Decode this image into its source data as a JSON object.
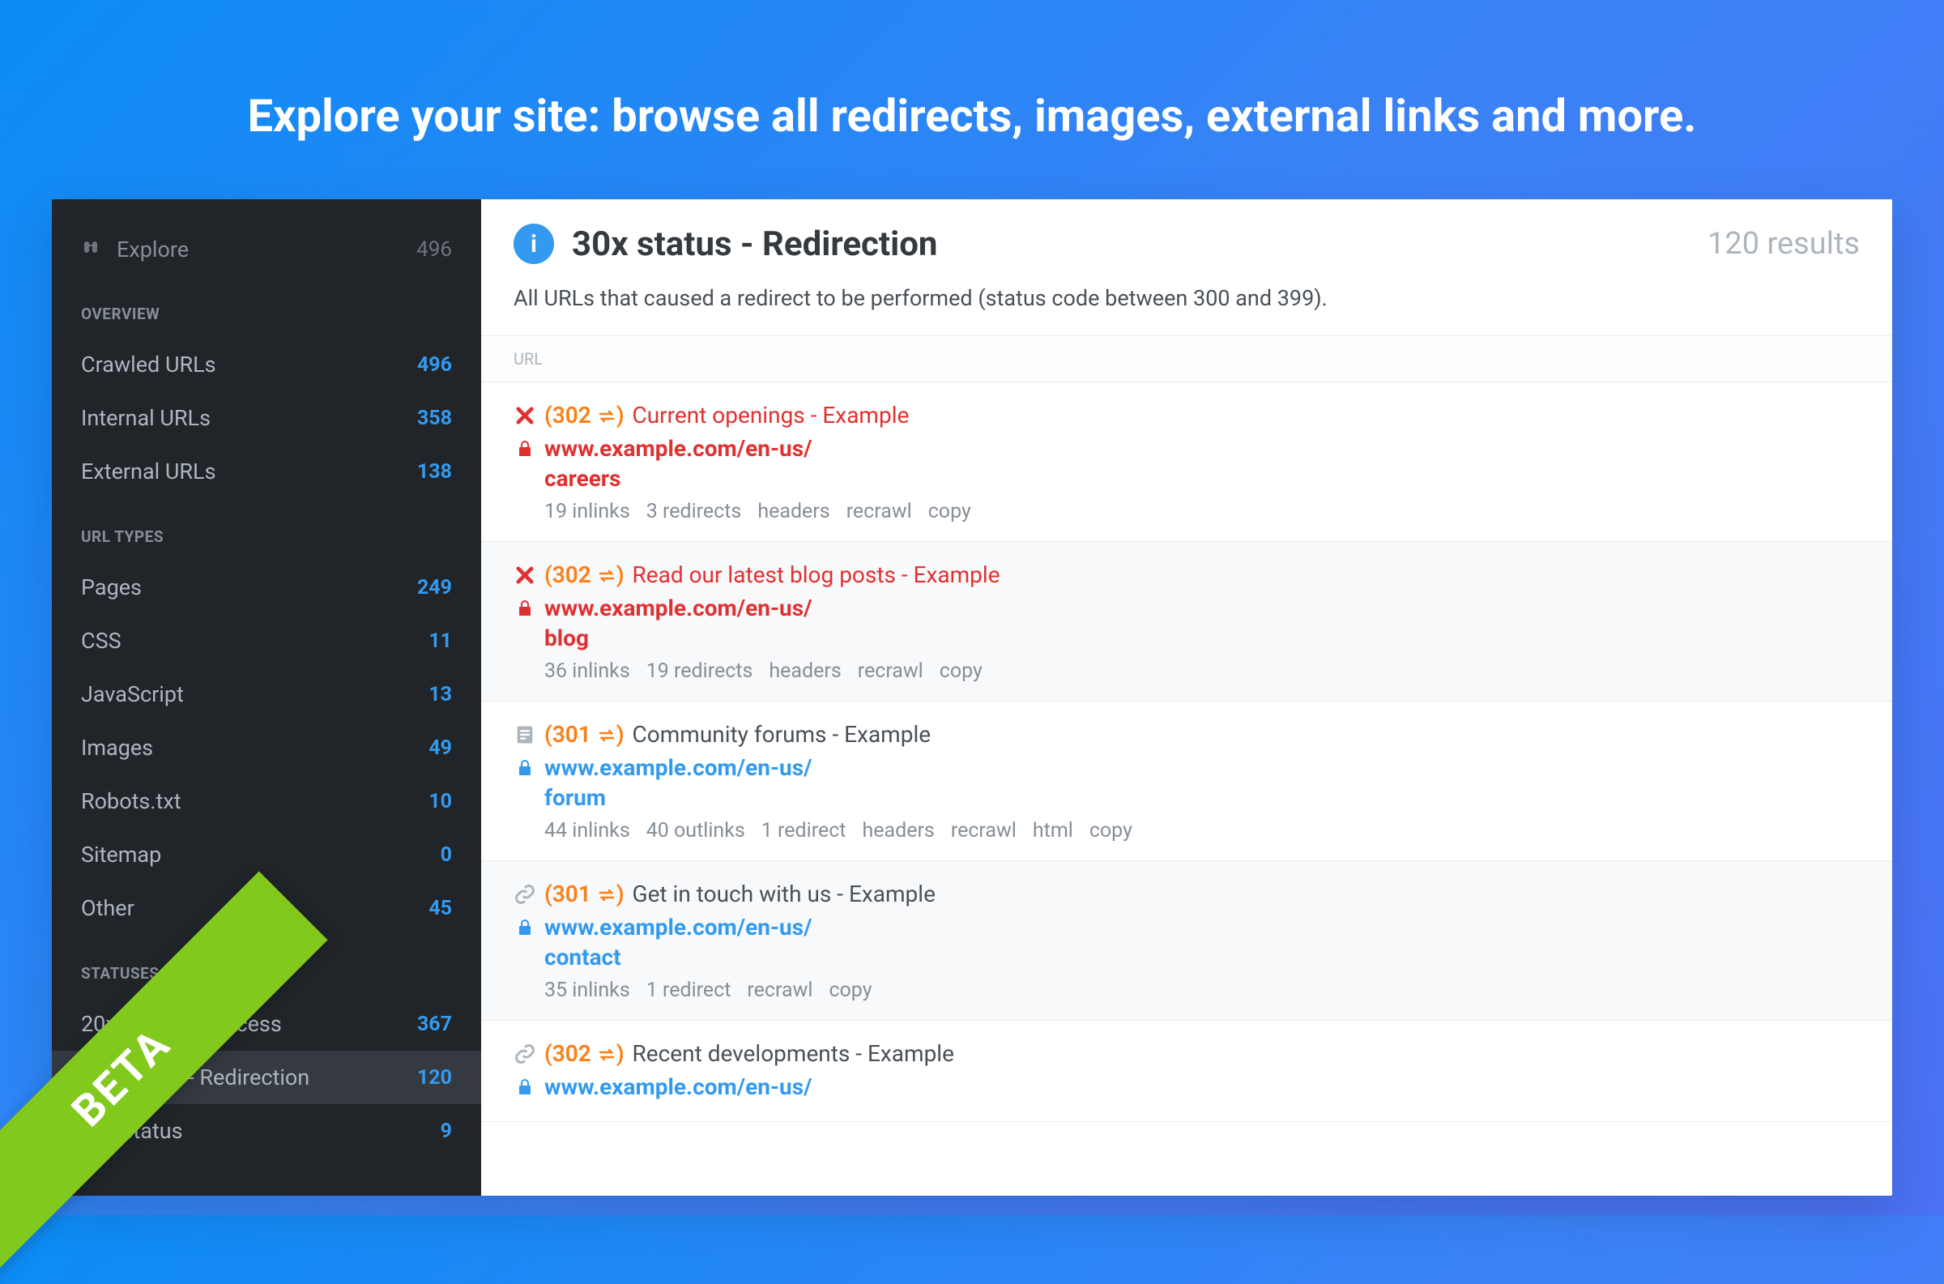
{
  "hero": {
    "title": "Explore your site: browse all redirects, images, external links and more."
  },
  "sidebar": {
    "explore": {
      "label": "Explore",
      "count": "496"
    },
    "sections": {
      "overview": {
        "header": "OVERVIEW",
        "items": [
          {
            "label": "Crawled URLs",
            "count": "496"
          },
          {
            "label": "Internal URLs",
            "count": "358"
          },
          {
            "label": "External URLs",
            "count": "138"
          }
        ]
      },
      "url_types": {
        "header": "URL TYPES",
        "items": [
          {
            "label": "Pages",
            "count": "249"
          },
          {
            "label": "CSS",
            "count": "11"
          },
          {
            "label": "JavaScript",
            "count": "13"
          },
          {
            "label": "Images",
            "count": "49"
          },
          {
            "label": "Robots.txt",
            "count": "10"
          },
          {
            "label": "Sitemap",
            "count": "0"
          },
          {
            "label": "Other",
            "count": "45"
          }
        ]
      },
      "statuses": {
        "header": "STATUSES",
        "items": [
          {
            "label": "20x status - Success",
            "count": "367"
          },
          {
            "label": "30x status - Redirection",
            "count": "120"
          },
          {
            "label": "40x status",
            "count": "9"
          }
        ]
      }
    }
  },
  "page": {
    "title": "30x status - Redirection",
    "results": "120 results",
    "description": "All URLs that caused a redirect to be performed (status code between 300 and 399).",
    "col_header": "URL"
  },
  "items": [
    {
      "icon": "x",
      "color": "red",
      "code": "(302 ⇄)",
      "title": "Current openings - Example",
      "domain": "www.example.com",
      "path": "/en-us/",
      "slug": "careers",
      "meta": [
        "19 inlinks",
        "3 redirects",
        "headers",
        "recrawl",
        "copy"
      ]
    },
    {
      "icon": "x",
      "color": "red",
      "alt": true,
      "code": "(302 ⇄)",
      "title": "Read our latest blog posts - Example",
      "domain": "www.example.com",
      "path": "/en-us/",
      "slug": "blog",
      "meta": [
        "36 inlinks",
        "19 redirects",
        "headers",
        "recrawl",
        "copy"
      ]
    },
    {
      "icon": "doc",
      "color": "blue",
      "code": "(301 ⇄)",
      "title": "Community forums - Example",
      "domain": "www.example.com",
      "path": "/en-us/",
      "slug": "forum",
      "meta": [
        "44 inlinks",
        "40 outlinks",
        "1 redirect",
        "headers",
        "recrawl",
        "html",
        "copy"
      ]
    },
    {
      "icon": "link",
      "color": "blue",
      "alt": true,
      "code": "(301 ⇄)",
      "title": "Get in touch with us - Example",
      "domain": "www.example.com",
      "path": "/en-us/",
      "slug": "contact",
      "meta": [
        "35 inlinks",
        "1 redirect",
        "recrawl",
        "copy"
      ]
    },
    {
      "icon": "link",
      "color": "blue",
      "code": "(302 ⇄)",
      "title": "Recent developments - Example",
      "domain": "www.example.com",
      "path": "/en-us/",
      "slug": "",
      "meta": []
    }
  ],
  "ribbon": {
    "label": "BETA"
  },
  "info_badge": "i"
}
